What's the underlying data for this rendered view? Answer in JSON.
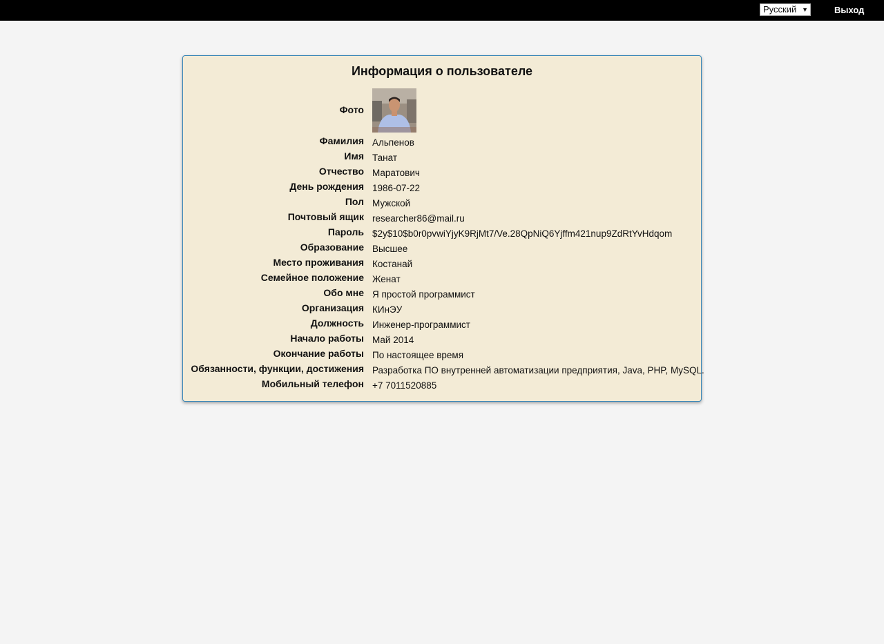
{
  "topbar": {
    "language_selected": "Русский",
    "logout_label": "Выход"
  },
  "card": {
    "title": "Информация о пользователе",
    "photo_label": "Фото",
    "fields": [
      {
        "label": "Фамилия",
        "value": "Альпенов"
      },
      {
        "label": "Имя",
        "value": "Танат"
      },
      {
        "label": "Отчество",
        "value": "Маратович"
      },
      {
        "label": "День рождения",
        "value": "1986-07-22"
      },
      {
        "label": "Пол",
        "value": "Мужской"
      },
      {
        "label": "Почтовый ящик",
        "value": "researcher86@mail.ru"
      },
      {
        "label": "Пароль",
        "value": "$2y$10$b0r0pvwiYjyK9RjMt7/Ve.28QpNiQ6Yjffm421nup9ZdRtYvHdqom"
      },
      {
        "label": "Образование",
        "value": "Высшее"
      },
      {
        "label": "Место проживания",
        "value": "Костанай"
      },
      {
        "label": "Семейное положение",
        "value": "Женат"
      },
      {
        "label": "Обо мне",
        "value": "Я простой программист"
      },
      {
        "label": "Организация",
        "value": "КИнЭУ"
      },
      {
        "label": "Должность",
        "value": "Инженер-программист"
      },
      {
        "label": "Начало работы",
        "value": "Май 2014"
      },
      {
        "label": "Окончание работы",
        "value": "По настоящее время"
      },
      {
        "label": "Обязанности, функции, достижения",
        "value": "Разработка ПО внутренней автоматизации предприятия, Java, PHP, MySQL."
      },
      {
        "label": "Мобильный телефон",
        "value": "+7 7011520885"
      }
    ]
  },
  "icons": {
    "dropdown": "chevron-down-icon"
  }
}
